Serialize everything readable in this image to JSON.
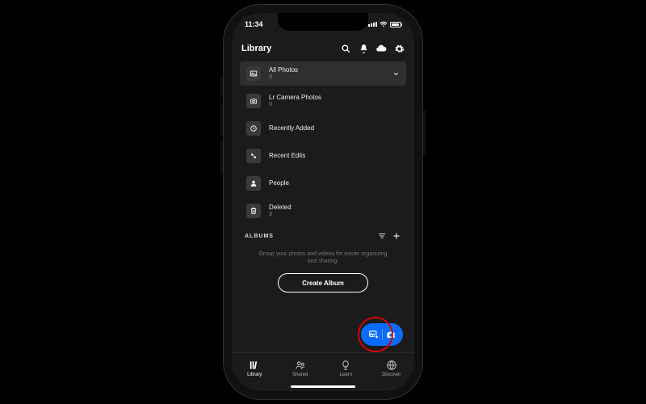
{
  "status": {
    "time": "11:34"
  },
  "header": {
    "title": "Library"
  },
  "rows": [
    {
      "title": "All Photos",
      "sub": "0"
    },
    {
      "title": "Lr Camera Photos",
      "sub": "0"
    },
    {
      "title": "Recently Added",
      "sub": ""
    },
    {
      "title": "Recent Edits",
      "sub": ""
    },
    {
      "title": "People",
      "sub": ""
    },
    {
      "title": "Deleted",
      "sub": "3"
    }
  ],
  "albums": {
    "section_title": "ALBUMS",
    "hint": "Group your photos and videos for easier organizing and sharing.",
    "create_label": "Create Album"
  },
  "tabs": [
    {
      "label": "Library"
    },
    {
      "label": "Shared"
    },
    {
      "label": "Learn"
    },
    {
      "label": "Discover"
    }
  ]
}
